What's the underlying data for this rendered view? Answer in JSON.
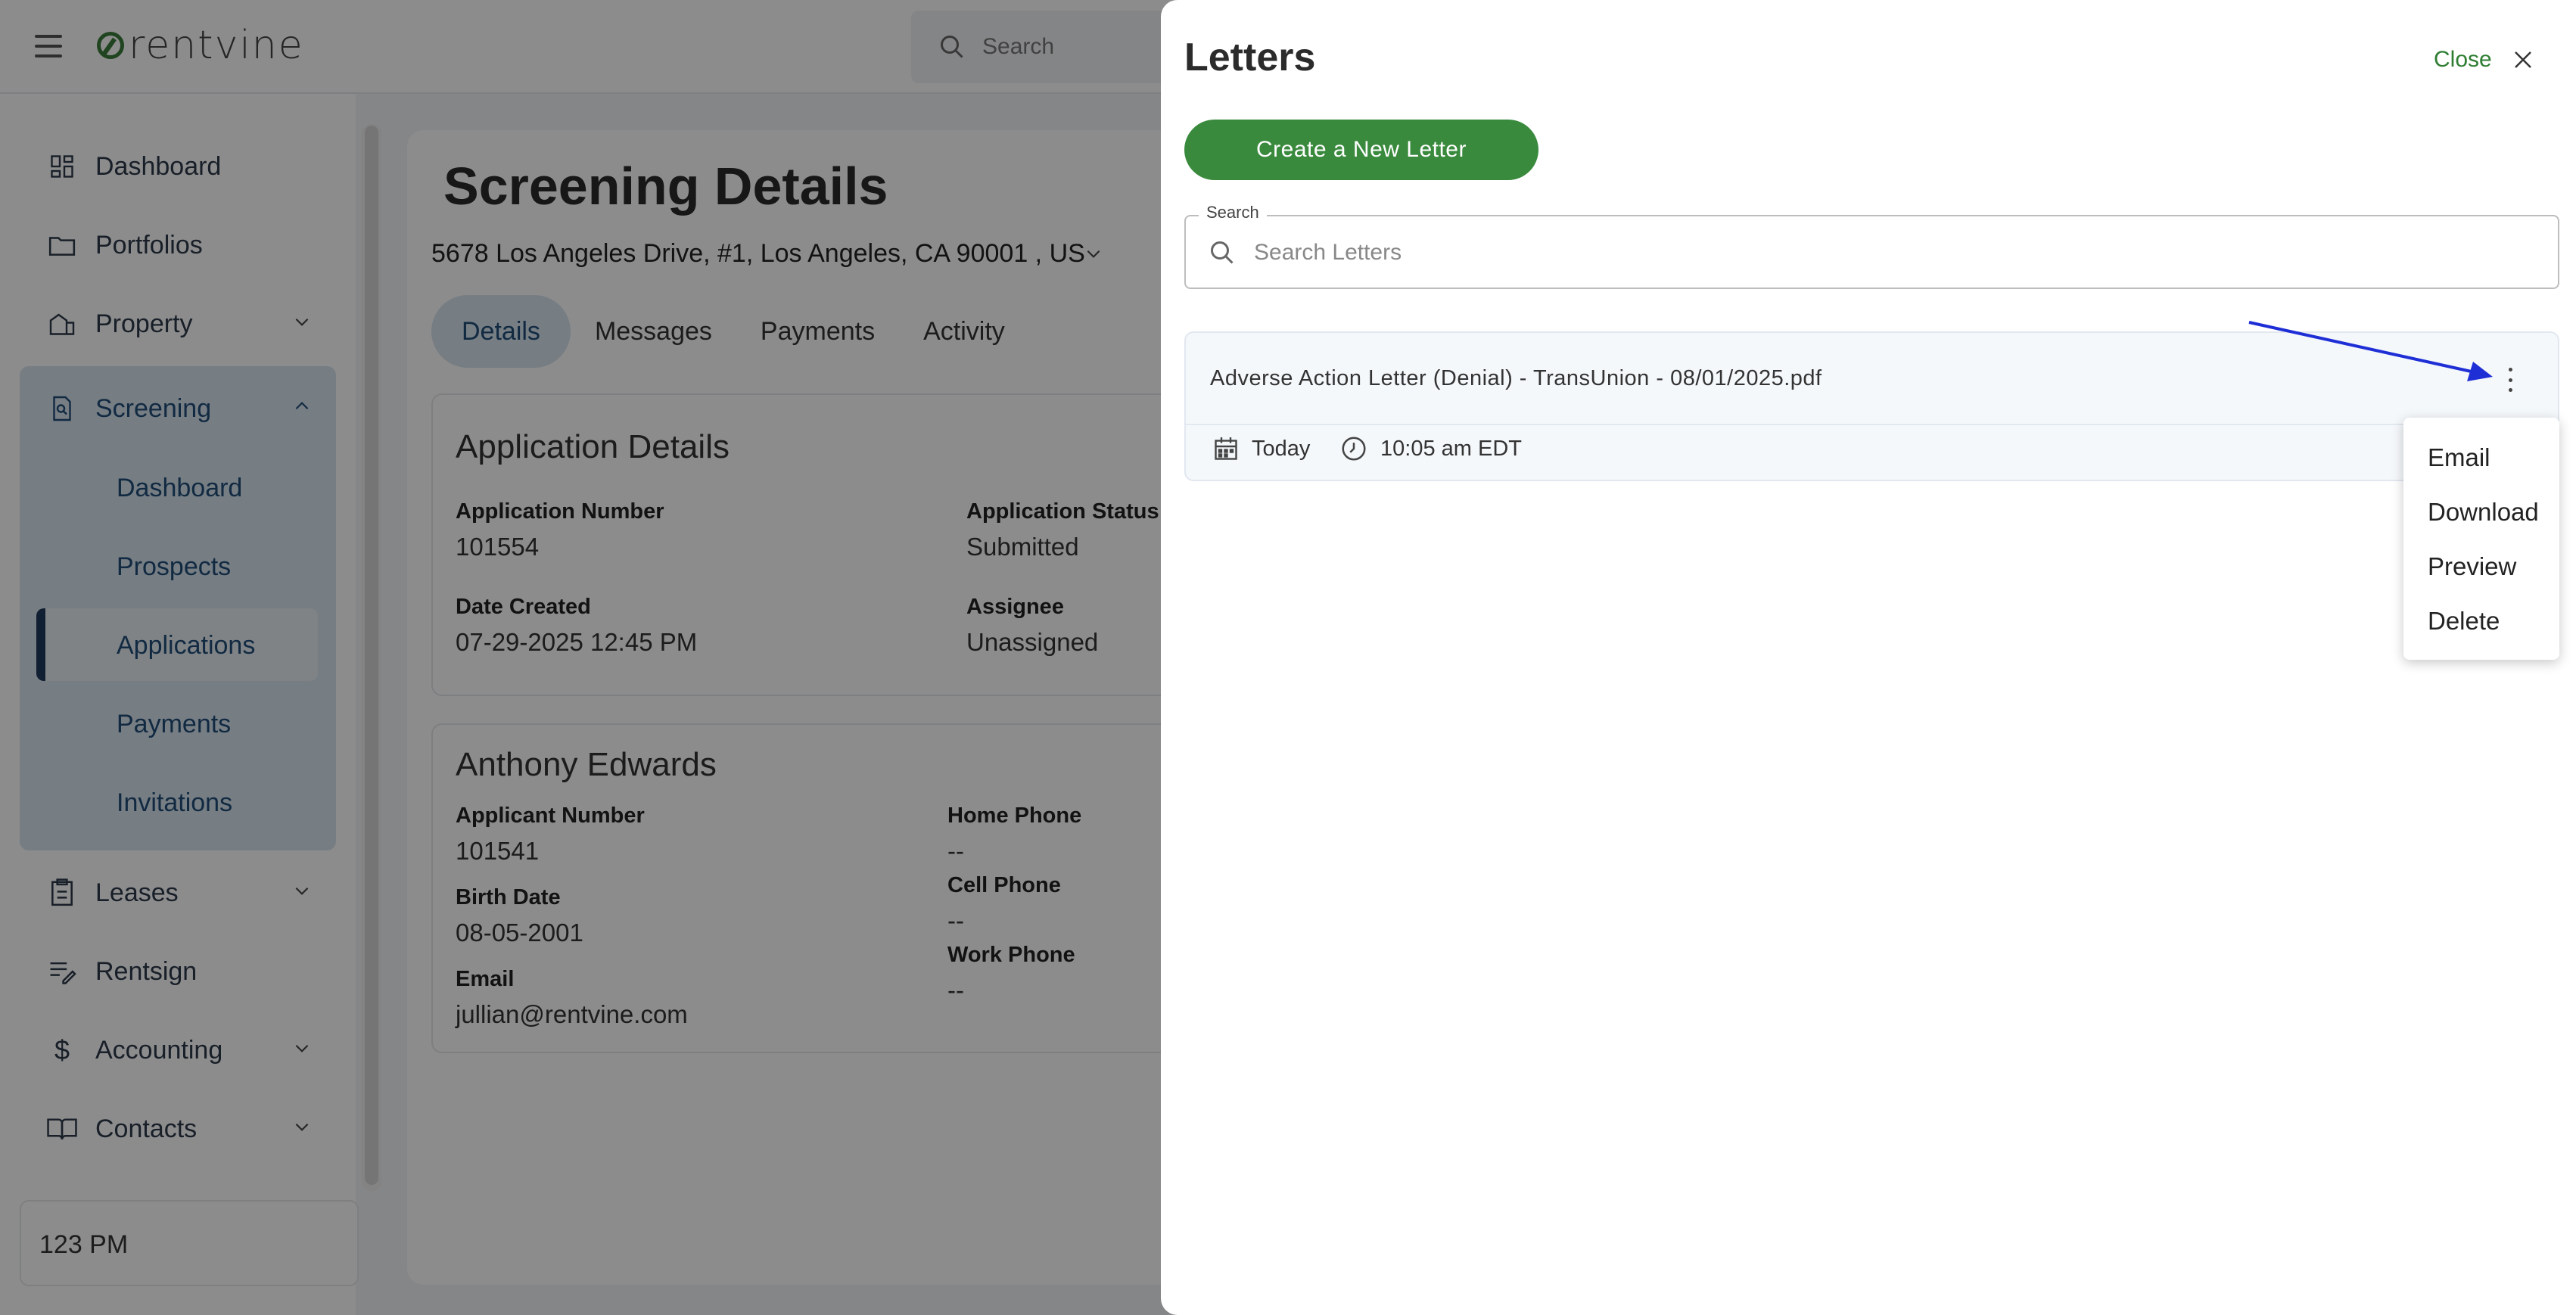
{
  "app": {
    "logo_text": "rentvine"
  },
  "topbar": {
    "search_placeholder": "Search"
  },
  "sidebar": {
    "items": [
      {
        "label": "Dashboard",
        "icon": "dashboard-icon"
      },
      {
        "label": "Portfolios",
        "icon": "folder-icon"
      },
      {
        "label": "Property",
        "icon": "property-icon"
      },
      {
        "label": "Screening",
        "icon": "screening-icon"
      },
      {
        "label": "Leases",
        "icon": "lease-icon"
      },
      {
        "label": "Rentsign",
        "icon": "rentsign-icon"
      },
      {
        "label": "Accounting",
        "icon": "dollar-icon"
      },
      {
        "label": "Contacts",
        "icon": "book-icon"
      }
    ],
    "screening_sub": [
      "Dashboard",
      "Prospects",
      "Applications",
      "Payments",
      "Invitations"
    ],
    "account_label": "123 PM"
  },
  "page": {
    "title": "Screening Details",
    "address": "5678 Los Angeles Drive, #1, Los Angeles, CA 90001 , US",
    "tabs": [
      "Details",
      "Messages",
      "Payments",
      "Activity"
    ],
    "application": {
      "title": "Application Details",
      "number_label": "Application Number",
      "number": "101554",
      "status_label": "Application Status",
      "status": "Submitted",
      "created_label": "Date Created",
      "created": "07-29-2025 12:45 PM",
      "assignee_label": "Assignee",
      "assignee": "Unassigned"
    },
    "applicant": {
      "name": "Anthony Edwards",
      "number_label": "Applicant Number",
      "number": "101541",
      "birth_label": "Birth Date",
      "birth": "08-05-2001",
      "email_label": "Email",
      "email": "jullian@rentvine.com",
      "home_label": "Home Phone",
      "home": "--",
      "cell_label": "Cell Phone",
      "cell": "--",
      "work_label": "Work Phone",
      "work": "--"
    }
  },
  "drawer": {
    "title": "Letters",
    "close_label": "Close",
    "create_label": "Create a New Letter",
    "search_label": "Search",
    "search_placeholder": "Search Letters",
    "letter": {
      "name": "Adverse Action Letter (Denial) - TransUnion - 08/01/2025.pdf",
      "date": "Today",
      "time": "10:05 am EDT"
    },
    "menu": [
      "Email",
      "Download",
      "Preview",
      "Delete"
    ]
  },
  "colors": {
    "accent_green": "#3a8a3e",
    "nav_blue": "#1f4e79",
    "annotation_arrow": "#1f2fd6"
  }
}
